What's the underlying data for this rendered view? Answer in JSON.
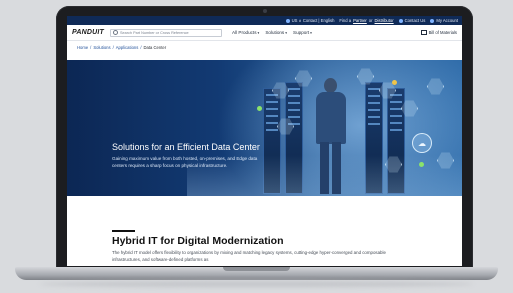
{
  "utility_bar": {
    "locale": "US ∧ Contact | English",
    "find_prefix": "Find a",
    "find_partner": "Partner",
    "find_or": "or",
    "find_distributor": "Distributor",
    "contact": "Contact Us",
    "account": "My Account"
  },
  "header": {
    "logo_text": "PANDUIT",
    "search_placeholder": "Search Part Number or Cross Reference",
    "nav": [
      "All Products",
      "Solutions",
      "Support"
    ],
    "bill_of_materials": "Bill of Materials"
  },
  "breadcrumb": [
    "Home",
    "Solutions",
    "Applications",
    "Data Center"
  ],
  "hero": {
    "title": "Solutions for an Efficient Data Center",
    "body": "Gaining maximum value from both hosted, on-premises, and Edge data centers requires a sharp focus on physical infrastructure."
  },
  "section": {
    "heading": "Hybrid IT for Digital Modernization",
    "body": "The hybrid IT model offers flexibility to organizations by mixing and matching legacy systems, cutting-edge hyper-converged and composable infrastructures, and software-defined platforms as"
  },
  "colors": {
    "utility_bar": "#0f2a57",
    "hero_dark": "#0c2754",
    "hero_light": "#2d6aa8",
    "link": "#1f4f99"
  },
  "icons": [
    "globe-icon",
    "phone-icon",
    "user-icon",
    "search-icon",
    "document-icon",
    "cloud-icon"
  ]
}
